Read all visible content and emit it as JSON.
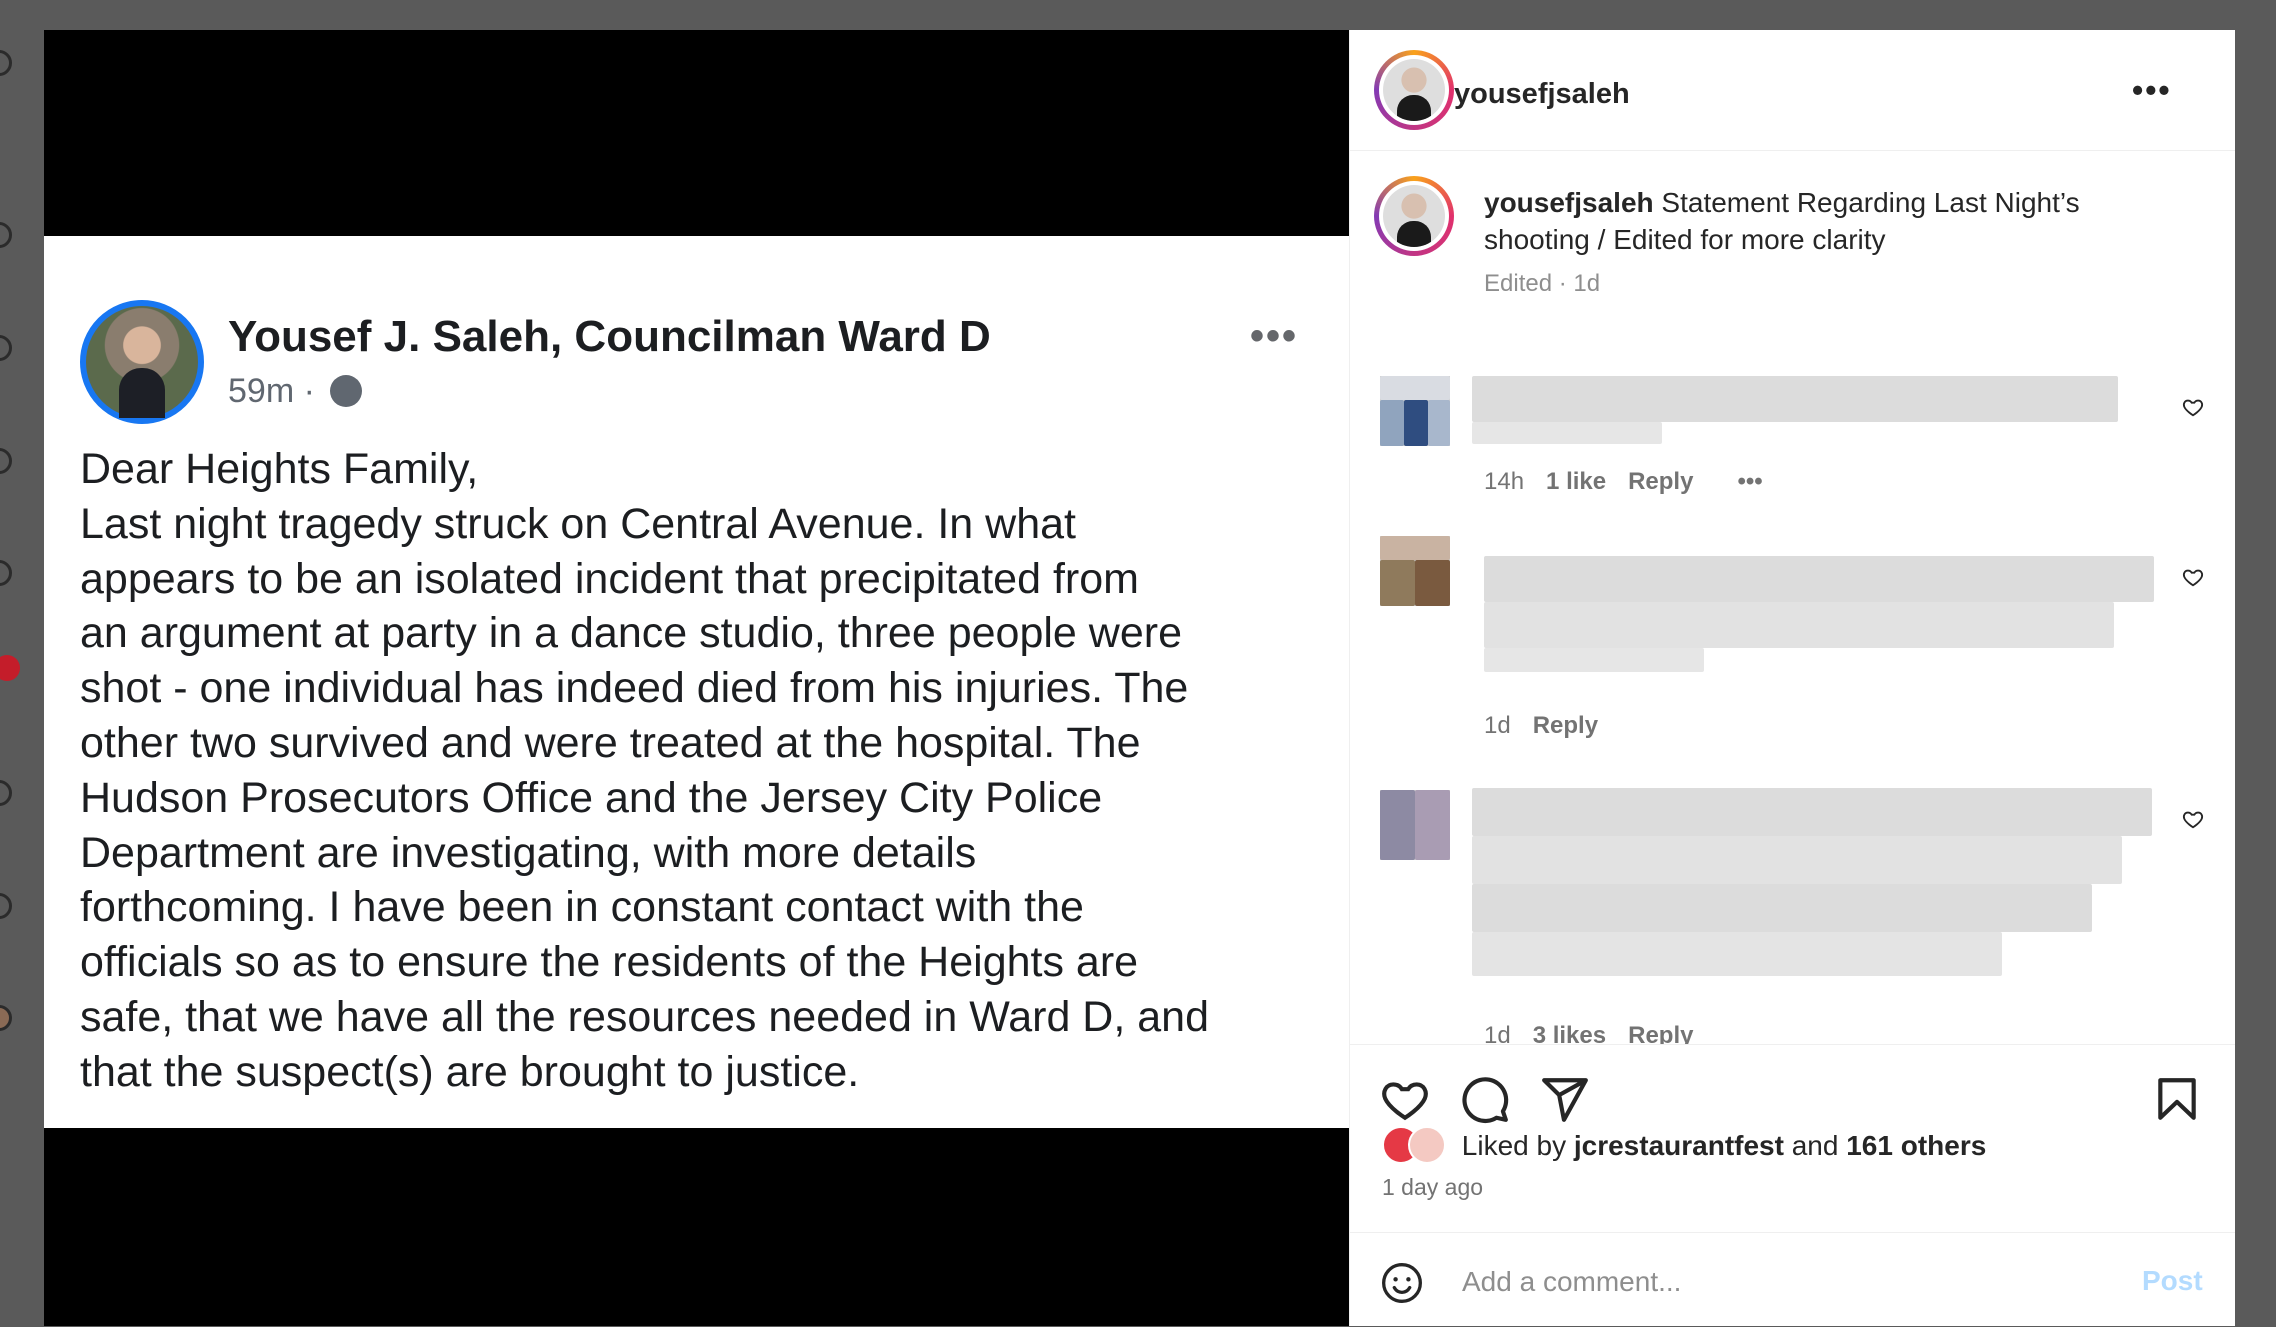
{
  "media": {
    "fb_post": {
      "author": "Yousef J. Saleh, Councilman Ward D",
      "time": "59m",
      "separator": "·",
      "more": "•••",
      "body_lines": [
        "Dear Heights Family,",
        "Last night tragedy struck on Central Avenue. In what",
        "appears to be an isolated incident that precipitated from",
        "an argument at party in a dance studio, three people were",
        "shot - one individual has indeed died from his injuries. The",
        "other two survived and were treated at the hospital. The",
        "Hudson Prosecutors Office and the Jersey City Police",
        "Department are investigating, with more details",
        "forthcoming. I have been in constant contact with the",
        "officials so as to ensure the residents of the Heights are",
        "safe, that we have all the resources needed in Ward D, and",
        "that the suspect(s) are brought to justice."
      ]
    }
  },
  "header": {
    "username": "yousefjsaleh",
    "more": "•••"
  },
  "caption": {
    "username": "yousefjsaleh",
    "text": "Statement Regarding Last Night’s shooting / Edited for more clarity",
    "meta": "Edited · 1d"
  },
  "comments": [
    {
      "time": "14h",
      "likes": "1 like",
      "reply": "Reply",
      "more": "•••"
    },
    {
      "time": "1d",
      "reply": "Reply"
    },
    {
      "time": "1d",
      "likes": "3 likes",
      "reply": "Reply"
    }
  ],
  "likes": {
    "prefix": "Liked by",
    "user": "jcrestaurantfest",
    "conj": "and",
    "others": "161 others",
    "ago": "1 day ago"
  },
  "add_comment": {
    "placeholder": "Add a comment...",
    "post": "Post"
  },
  "icons": [
    "heart-icon",
    "comment-icon",
    "share-icon",
    "bookmark-icon",
    "emoji-icon",
    "globe-icon",
    "more-icon"
  ],
  "colors": {
    "facebook_blue": "#1877f2",
    "post_disabled": "#b3dbff",
    "ig_text": "#262626",
    "ig_secondary": "#737373"
  }
}
